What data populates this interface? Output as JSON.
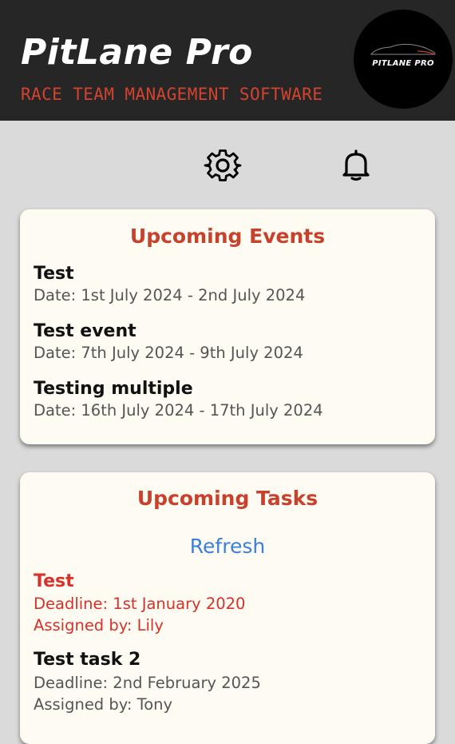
{
  "header": {
    "title": "PitLane Pro",
    "subtitle": "RACE TEAM MANAGEMENT SOFTWARE",
    "logo_text": "PITLANE PRO"
  },
  "toolbar": {
    "settings_icon": "gear-icon",
    "notifications_icon": "bell-icon"
  },
  "events": {
    "title": "Upcoming Events",
    "items": [
      {
        "name": "Test",
        "date": "Date: 1st July 2024 - 2nd July 2024"
      },
      {
        "name": "Test event",
        "date": "Date: 7th July 2024 - 9th July 2024"
      },
      {
        "name": "Testing multiple",
        "date": "Date: 16th July 2024 - 17th July 2024"
      }
    ]
  },
  "tasks": {
    "title": "Upcoming Tasks",
    "refresh_label": "Refresh",
    "items": [
      {
        "name": "Test",
        "deadline": "Deadline: 1st January 2020",
        "assigned": "Assigned by: Lily"
      },
      {
        "name": "Test task 2",
        "deadline": "Deadline: 2nd February 2025",
        "assigned": "Assigned by: Tony"
      }
    ]
  },
  "colors": {
    "header_bg": "#262626",
    "accent_red": "#c8412c",
    "overdue_red": "#d8312a",
    "link_blue": "#3a7fd8",
    "card_bg": "#fdfbf2",
    "page_bg": "#dadada"
  }
}
